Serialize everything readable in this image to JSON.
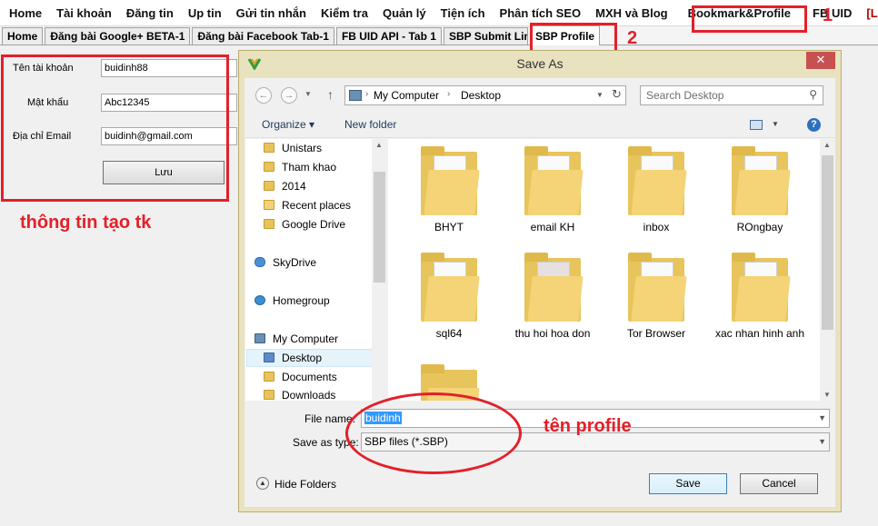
{
  "menu": [
    "Home",
    "Tài khoản",
    "Đăng tin",
    "Up tin",
    "Gửi tin nhắn",
    "Kiểm tra",
    "Quản lý",
    "Tiện ích",
    "Phân tích SEO",
    "MXH và Blog",
    "Bookmark&Profile",
    "FB UID",
    "[L"
  ],
  "tabs": [
    "Home",
    "Đăng bài Google+ BETA-1",
    "Đăng bài Facebook Tab-1",
    "FB UID API - Tab 1",
    "SBP Submit Lin",
    "SBP Profile"
  ],
  "form": {
    "username_label": "Tên tài khoản",
    "username_value": "buidinh88",
    "password_label": "Mật khẩu",
    "password_value": "Abc12345",
    "email_label": "Địa chỉ Email",
    "email_value": "buidinh@gmail.com",
    "save_label": "Lưu"
  },
  "annotations": {
    "num1": "1",
    "num2": "2",
    "account_info": "thông tin tạo tk",
    "profile_name": "tên profile",
    "color": "#e3202a"
  },
  "dialog": {
    "title": "Save As",
    "close": "✕",
    "path": [
      "My Computer",
      "Desktop"
    ],
    "search_placeholder": "Search Desktop",
    "organize": "Organize ▾",
    "new_folder": "New folder",
    "nav_items": [
      "Unistars",
      "Tham khao",
      "2014",
      "Recent places",
      "Google Drive",
      "SkyDrive",
      "Homegroup",
      "My Computer",
      "Desktop",
      "Documents",
      "Downloads"
    ],
    "files": [
      "BHYT",
      "email KH",
      "inbox",
      "ROngbay",
      "sql64",
      "thu hoi hoa don",
      "Tor Browser",
      "xac nhan hinh anh"
    ],
    "file_name_label": "File name:",
    "file_name_value": "buidinh",
    "save_type_label": "Save as type:",
    "save_type_value": "SBP files (*.SBP)",
    "hide_folders": "Hide Folders",
    "save_button": "Save",
    "cancel_button": "Cancel"
  }
}
